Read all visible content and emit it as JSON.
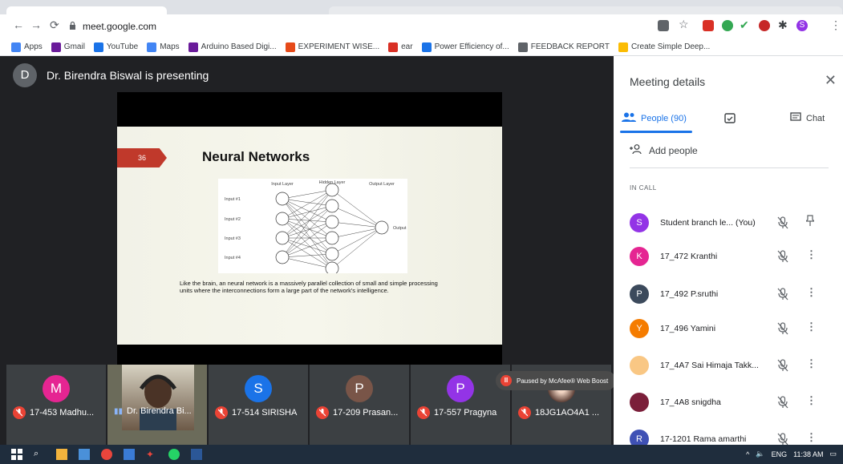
{
  "browser": {
    "url": "meet.google.com",
    "profile_initial": "S",
    "bookmarks": [
      {
        "label": "Apps",
        "icon": "apps-grid-icon",
        "color": "#4285f4"
      },
      {
        "label": "Gmail",
        "icon": "gmail-icon",
        "color": "#6a1b9a"
      },
      {
        "label": "YouTube",
        "icon": "youtube-icon",
        "color": "#1a73e8"
      },
      {
        "label": "Maps",
        "icon": "maps-icon",
        "color": "#4285f4"
      },
      {
        "label": "Arduino Based Digi...",
        "icon": "bookmark-icon",
        "color": "#6a1b9a"
      },
      {
        "label": "EXPERIMENT WISE...",
        "icon": "sheet-icon",
        "color": "#e64a19"
      },
      {
        "label": "ear",
        "icon": "gmail-icon",
        "color": "#d93025"
      },
      {
        "label": "Power Efficiency of...",
        "icon": "globe-icon",
        "color": "#1a73e8"
      },
      {
        "label": "FEEDBACK REPORT",
        "icon": "globe-icon",
        "color": "#5f6368"
      },
      {
        "label": "Create Simple Deep...",
        "icon": "google-icon",
        "color": "#fbbc04"
      }
    ]
  },
  "meeting": {
    "presenter_initial": "D",
    "presenter_text": "Dr. Birendra Biswal is presenting",
    "slide": {
      "number": "36",
      "title": "Neural Networks",
      "layer_labels": [
        "Input Layer",
        "Hidden Layer",
        "Output Layer"
      ],
      "inputs": [
        "Input #1",
        "Input #2",
        "Input #3",
        "Input #4"
      ],
      "output": "Output",
      "text": "Like the brain, an neural network is a massively parallel collection of small and simple processing units where the interconnections form a large part of the network's intelligence."
    },
    "tiles": [
      {
        "initial": "M",
        "name": "17-453 Madhu...",
        "color": "#e52592",
        "muted": true
      },
      {
        "initial": "",
        "name": "Dr. Birendra Bi...",
        "color": "#555",
        "muted": false,
        "video": true
      },
      {
        "initial": "S",
        "name": "17-514 SIRISHA",
        "color": "#1a73e8",
        "muted": true
      },
      {
        "initial": "P",
        "name": "17-209 Prasan...",
        "color": "#795548",
        "muted": true
      },
      {
        "initial": "P",
        "name": "17-557 Pragyna",
        "color": "#9334e6",
        "muted": true
      },
      {
        "initial": "",
        "name": "18JG1AO4A1 ...",
        "color": "#6d4c41",
        "muted": true,
        "photo": true
      }
    ],
    "mcafee": "Paused by McAfee® Web Boost"
  },
  "panel": {
    "title": "Meeting details",
    "tabs": {
      "people": "People (90)",
      "chat": "Chat"
    },
    "add_people": "Add people",
    "in_call": "IN CALL",
    "people": [
      {
        "initial": "S",
        "name": "Student branch le...  (You)",
        "color": "#9334e6",
        "action": "pin"
      },
      {
        "initial": "K",
        "name": "17_472 Kranthi",
        "color": "#e52592",
        "action": "more"
      },
      {
        "initial": "P",
        "name": "17_492 P.sruthi",
        "color": "#3c4a5c",
        "action": "more"
      },
      {
        "initial": "Y",
        "name": "17_496 Yamini",
        "color": "#f57c00",
        "action": "more"
      },
      {
        "initial": "",
        "name": "17_4A7 Sai Himaja Takk...",
        "color": "#f9c784",
        "action": "more"
      },
      {
        "initial": "",
        "name": "17_4A8 snigdha",
        "color": "#7b1f3a",
        "action": "more"
      },
      {
        "initial": "R",
        "name": "17-1201 Rama amarthi",
        "color": "#3f51b5",
        "action": "more"
      }
    ]
  },
  "taskbar": {
    "lang": "ENG",
    "time": "11:38 AM"
  }
}
